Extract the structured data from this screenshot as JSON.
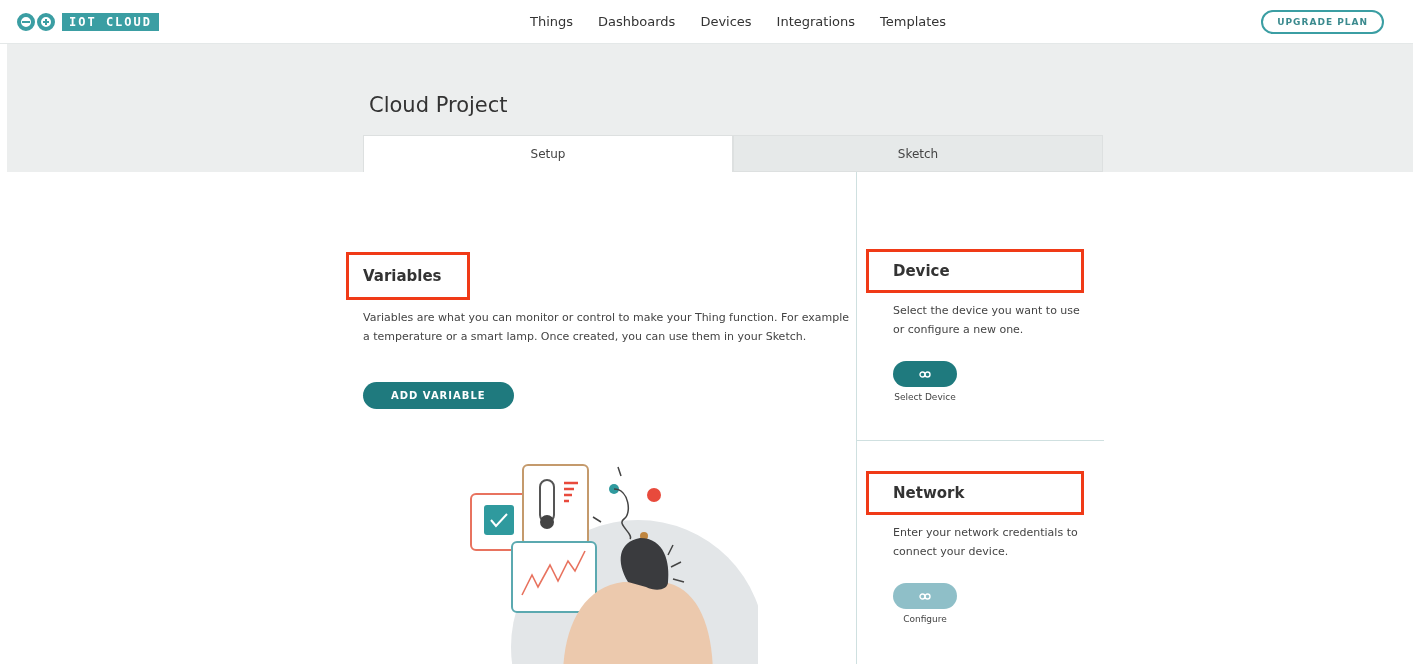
{
  "logo": {
    "text": "IOT CLOUD"
  },
  "nav": [
    {
      "label": "Things"
    },
    {
      "label": "Dashboards"
    },
    {
      "label": "Devices"
    },
    {
      "label": "Integrations"
    },
    {
      "label": "Templates"
    }
  ],
  "upgrade_button": "UPGRADE PLAN",
  "project": {
    "title": "Cloud Project"
  },
  "tabs": [
    {
      "label": "Setup",
      "selected": true
    },
    {
      "label": "Sketch",
      "selected": false
    }
  ],
  "variables": {
    "heading": "Variables",
    "highlighted": true,
    "text": "Variables are what you can monitor or control to make your Thing function. For example a temperature or a smart lamp. Once created, you can use them in your Sketch.",
    "button": "ADD VARIABLE"
  },
  "side_sections": [
    {
      "heading": "Device",
      "highlighted": true,
      "text": "Select the device you want to use or configure a new one.",
      "button_label": "Select Device",
      "disabled": false
    },
    {
      "heading": "Network",
      "highlighted": true,
      "text": "Enter your network credentials to connect your device.",
      "button_label": "Configure",
      "disabled": true
    }
  ]
}
